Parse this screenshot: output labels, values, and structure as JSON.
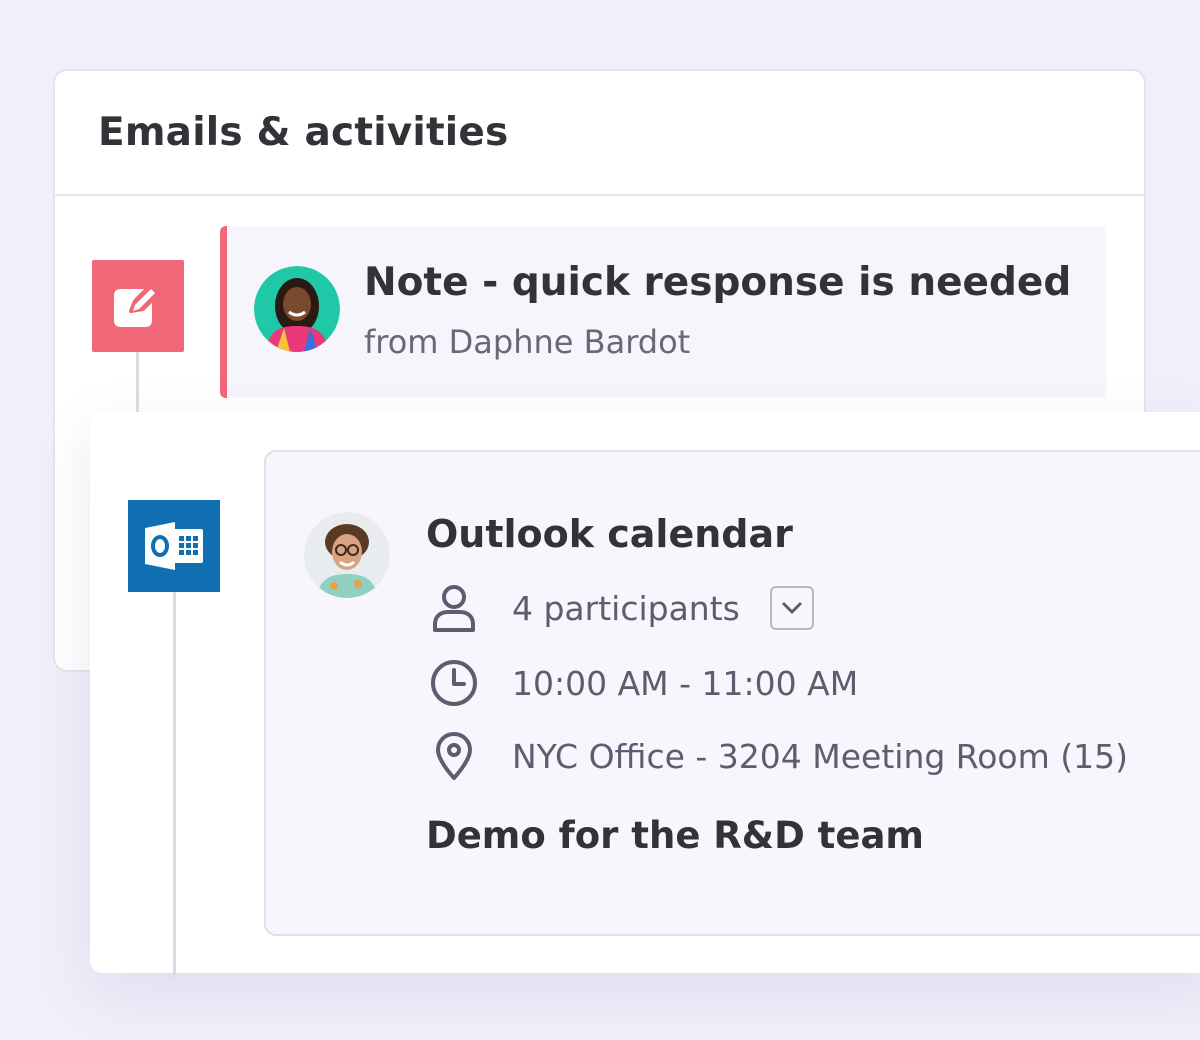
{
  "panel": {
    "title": "Emails & activities"
  },
  "note": {
    "title": "Note - quick response is needed",
    "from": "from Daphne Bardot",
    "icon": "edit-note-icon",
    "accent": "#f26778"
  },
  "event": {
    "title": "Outlook calendar",
    "icon": "outlook-calendar-icon",
    "accent": "#0f6fb0",
    "participants": "4 participants",
    "time": "10:00 AM - 11:00 AM",
    "location": "NYC Office - 3204 Meeting Room (15)",
    "description": "Demo for the R&D team"
  }
}
